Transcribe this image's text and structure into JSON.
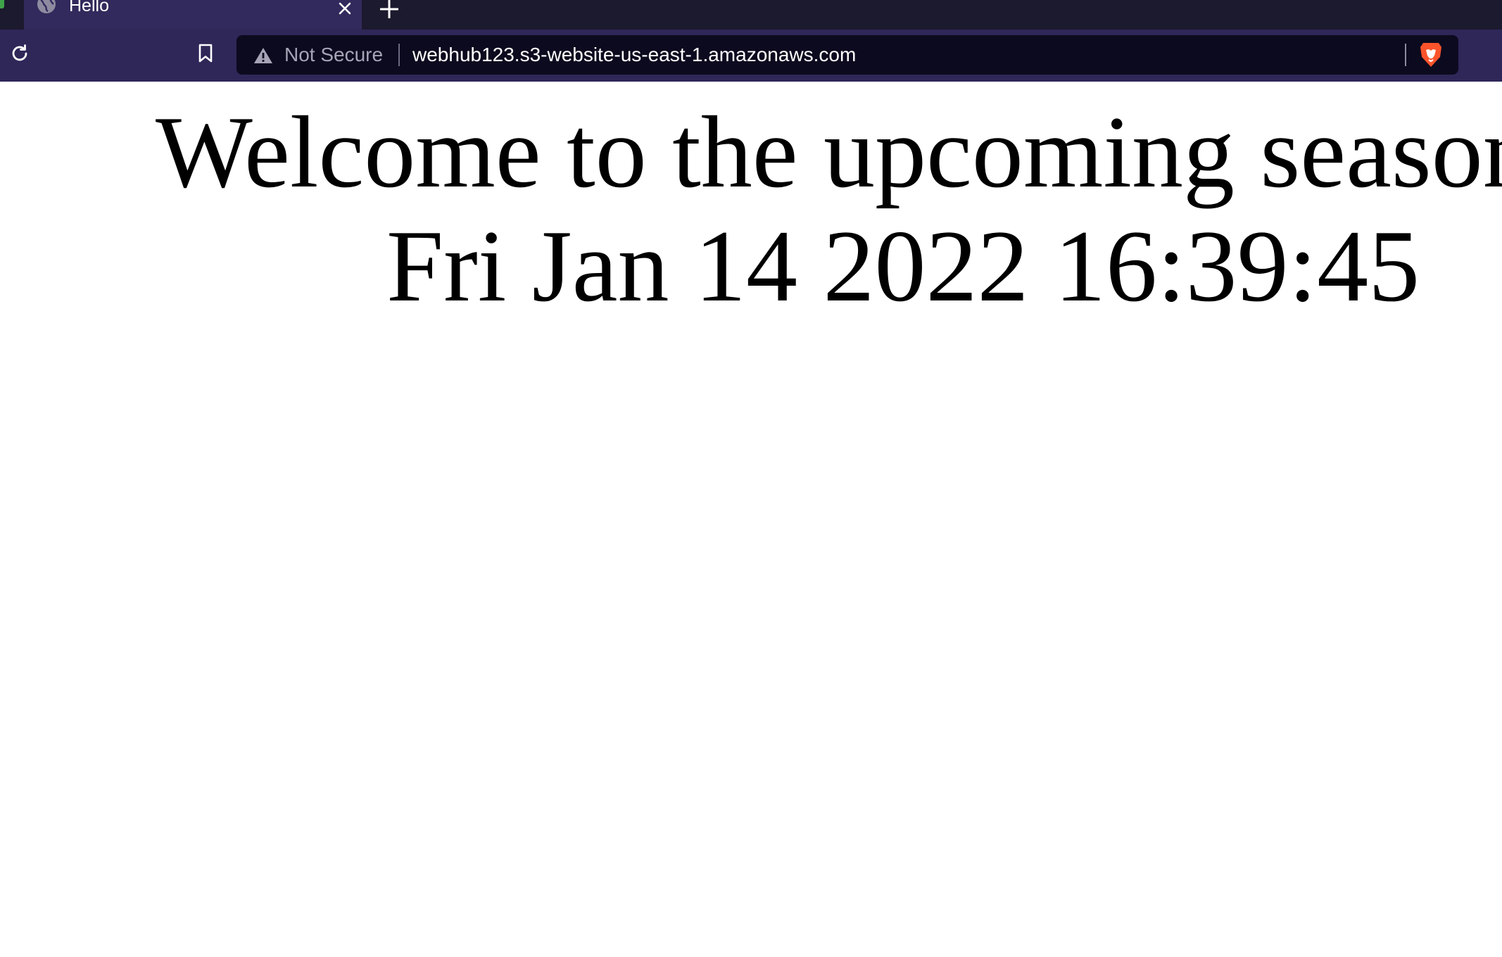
{
  "browser": {
    "tab": {
      "title": "Hello",
      "favicon": "globe-icon",
      "close_icon": "close-icon"
    },
    "new_tab_icon": "plus-icon",
    "toolbar": {
      "reload_icon": "reload-icon",
      "bookmark_icon": "bookmark-icon"
    },
    "address_bar": {
      "security_icon": "warning-icon",
      "security_label": "Not Secure",
      "url": "webhub123.s3-website-us-east-1.amazonaws.com",
      "shields_icon": "brave-lion-icon"
    },
    "colors": {
      "tabstrip": "#1c1a2e",
      "active_tab": "#322a5c",
      "toolbar": "#2e2758",
      "urlbar": "#0c0a1e",
      "brave_orange": "#fb542b"
    }
  },
  "page": {
    "heading": "Welcome to the upcoming season!",
    "date": "Fri Jan 14 2022 16:39:45",
    "background": "#ffffff",
    "text_color": "#000000"
  }
}
